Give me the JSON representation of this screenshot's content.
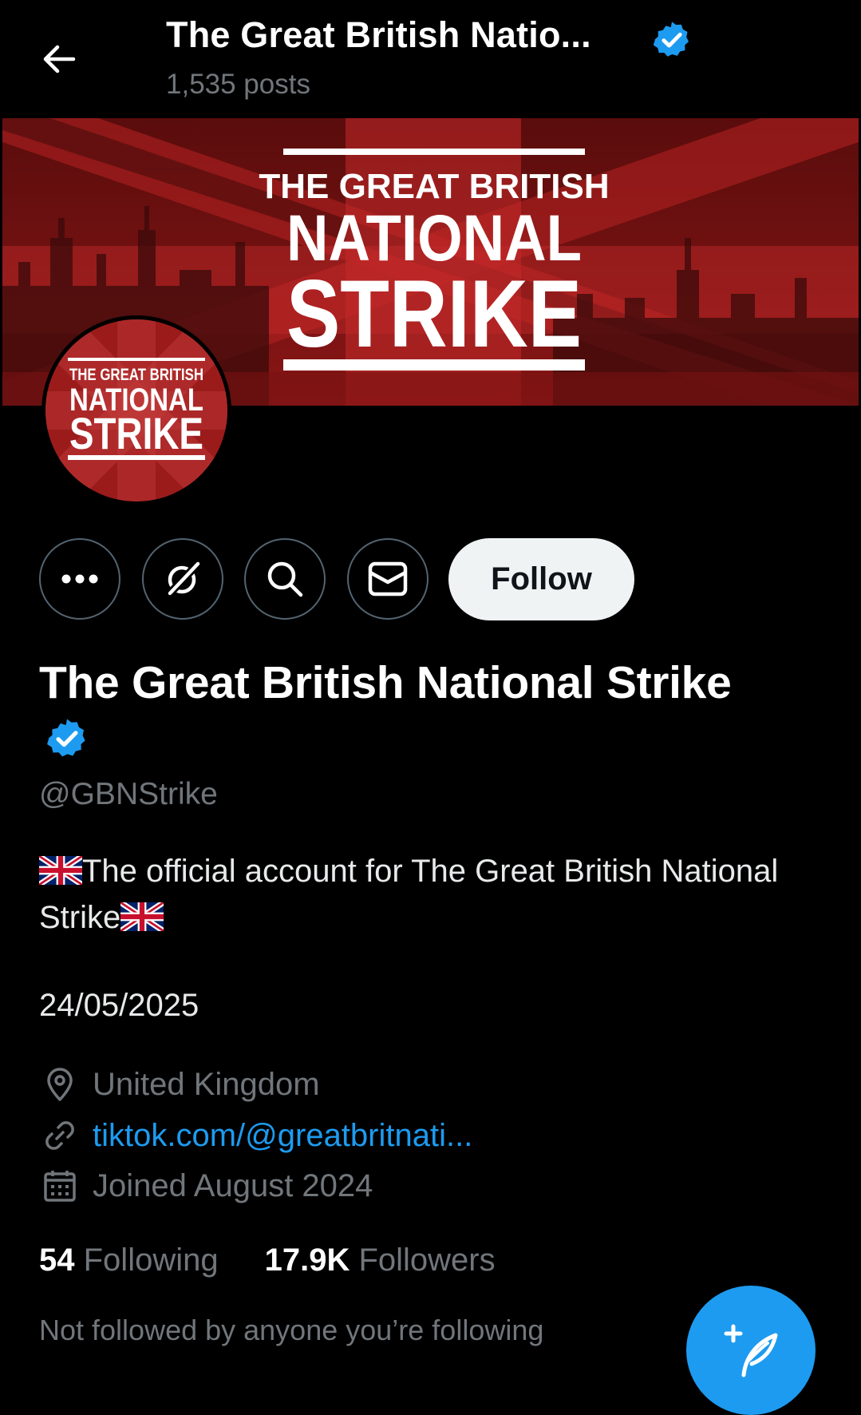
{
  "header": {
    "title": "The Great British Natio...",
    "posts_count": "1,535 posts",
    "back_icon": "arrow-left-icon",
    "verified_icon": "verified-badge-icon"
  },
  "banner": {
    "line1": "THE GREAT BRITISH",
    "line2": "NATIONAL",
    "line3": "STRIKE"
  },
  "avatar": {
    "line1": "THE GREAT BRITISH",
    "line2": "NATIONAL",
    "line3": "STRIKE"
  },
  "actions": {
    "more_icon": "more-dots-icon",
    "grok_icon": "grok-icon",
    "search_icon": "search-icon",
    "message_icon": "envelope-icon",
    "follow_label": "Follow"
  },
  "profile": {
    "display_name": "The Great British National Strike",
    "handle": "@GBNStrike",
    "bio_text": "The official account for The Great British National Strike",
    "bio_date": "24/05/2025",
    "location": "United Kingdom",
    "website": "tiktok.com/@greatbritnati...",
    "joined": "Joined August 2024"
  },
  "stats": {
    "following_count": "54",
    "following_label": "Following",
    "followers_count": "17.9K",
    "followers_label": "Followers"
  },
  "social_context": "Not followed by anyone you’re following",
  "colors": {
    "accent": "#1d9bf0",
    "background": "#000000",
    "muted": "#71767b",
    "banner_red": "#9b1b1b"
  }
}
